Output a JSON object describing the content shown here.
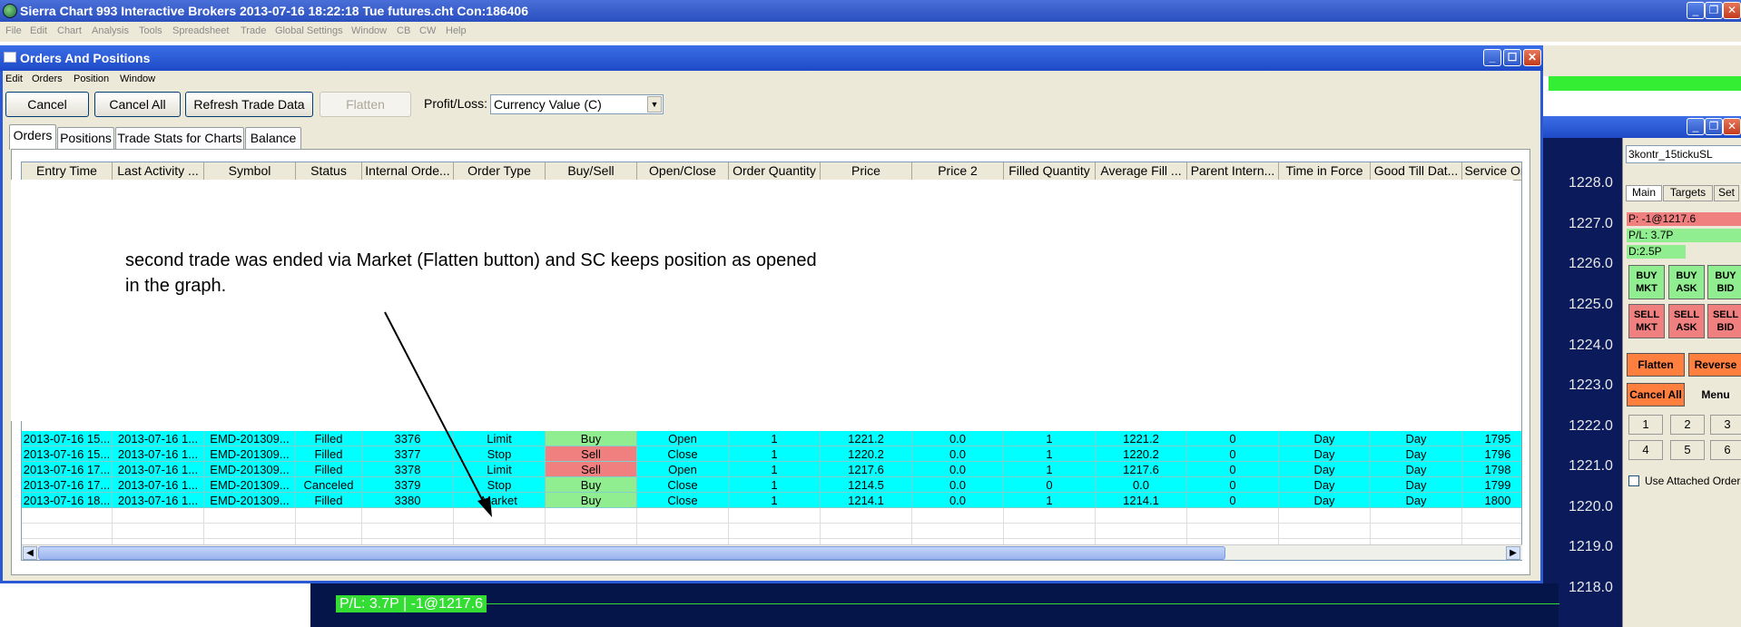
{
  "app": {
    "title": "Sierra Chart 993 Interactive Brokers 2013-07-16  18:22:18 Tue  futures.cht Con:186406",
    "menu": [
      "File",
      "Edit",
      "Chart",
      "Analysis",
      "Tools",
      "Spreadsheet",
      "Trade",
      "Global Settings",
      "Window",
      "CB",
      "CW",
      "Help"
    ]
  },
  "orders_window": {
    "title": "Orders And Positions",
    "menu": [
      "Edit",
      "Orders",
      "Position",
      "Window"
    ],
    "buttons": {
      "cancel": "Cancel",
      "cancel_all": "Cancel All",
      "refresh": "Refresh Trade Data",
      "flatten": "Flatten"
    },
    "pl_label": "Profit/Loss:",
    "pl_value": "Currency Value (C)",
    "tabs": [
      "Orders",
      "Positions",
      "Trade Stats for Charts",
      "Balance"
    ],
    "columns": [
      "Entry Time",
      "Last Activity ...",
      "Symbol",
      "Status",
      "Internal Orde...",
      "Order Type",
      "Buy/Sell",
      "Open/Close",
      "Order Quantity",
      "Price",
      "Price 2",
      "Filled Quantity",
      "Average Fill ...",
      "Parent Intern...",
      "Time in Force",
      "Good Till Dat...",
      "Service Orc"
    ],
    "rows": [
      [
        "2013-07-16 15...",
        "2013-07-16 1...",
        "EMD-201309...",
        "Filled",
        "3376",
        "Limit",
        "Buy",
        "Open",
        "1",
        "1221.2",
        "0.0",
        "1",
        "1221.2",
        "0",
        "Day",
        "Day",
        "1795"
      ],
      [
        "2013-07-16 15...",
        "2013-07-16 1...",
        "EMD-201309...",
        "Filled",
        "3377",
        "Stop",
        "Sell",
        "Close",
        "1",
        "1220.2",
        "0.0",
        "1",
        "1220.2",
        "0",
        "Day",
        "Day",
        "1796"
      ],
      [
        "2013-07-16 17...",
        "2013-07-16 1...",
        "EMD-201309...",
        "Filled",
        "3378",
        "Limit",
        "Sell",
        "Open",
        "1",
        "1217.6",
        "0.0",
        "1",
        "1217.6",
        "0",
        "Day",
        "Day",
        "1798"
      ],
      [
        "2013-07-16 17...",
        "2013-07-16 1...",
        "EMD-201309...",
        "Canceled",
        "3379",
        "Stop",
        "Buy",
        "Close",
        "1",
        "1214.5",
        "0.0",
        "0",
        "0.0",
        "0",
        "Day",
        "Day",
        "1799"
      ],
      [
        "2013-07-16 18...",
        "2013-07-16 1...",
        "EMD-201309...",
        "Filled",
        "3380",
        "Market",
        "Buy",
        "Close",
        "1",
        "1214.1",
        "0.0",
        "1",
        "1214.1",
        "0",
        "Day",
        "Day",
        "1800"
      ]
    ]
  },
  "annotation": "second trade was ended via Market (Flatten button) and SC keeps position as opened in the graph.",
  "chart": {
    "prices": [
      "1228.0",
      "1227.0",
      "1226.0",
      "1225.0",
      "1224.0",
      "1223.0",
      "1222.0",
      "1221.0",
      "1220.0",
      "1219.0",
      "1218.0"
    ]
  },
  "trade_panel": {
    "symbol": "3kontr_15tickuSL",
    "tabs": [
      "Main",
      "Targets",
      "Set"
    ],
    "position": "P: -1@1217.6",
    "pl": "P/L: 3.7P",
    "d": "D:2.5P",
    "buy_mkt": "BUY MKT",
    "buy_ask": "BUY ASK",
    "buy_bid": "BUY BID",
    "sell_mkt": "SELL MKT",
    "sell_ask": "SELL ASK",
    "sell_bid": "SELL BID",
    "flatten": "Flatten",
    "reverse": "Reverse",
    "cancel_all": "Cancel All",
    "menu": "Menu",
    "nums": [
      "1",
      "2",
      "3",
      "4",
      "5",
      "6"
    ],
    "use_attached": "Use Attached Orders"
  },
  "bottom_chart": {
    "pl_label": "P/L: 3.7P | -1@1217.6"
  },
  "colors": {
    "grid_row": "#00ffff",
    "buy": "#90ee90",
    "sell": "#f08080",
    "title_blue": "#2b58d4"
  }
}
